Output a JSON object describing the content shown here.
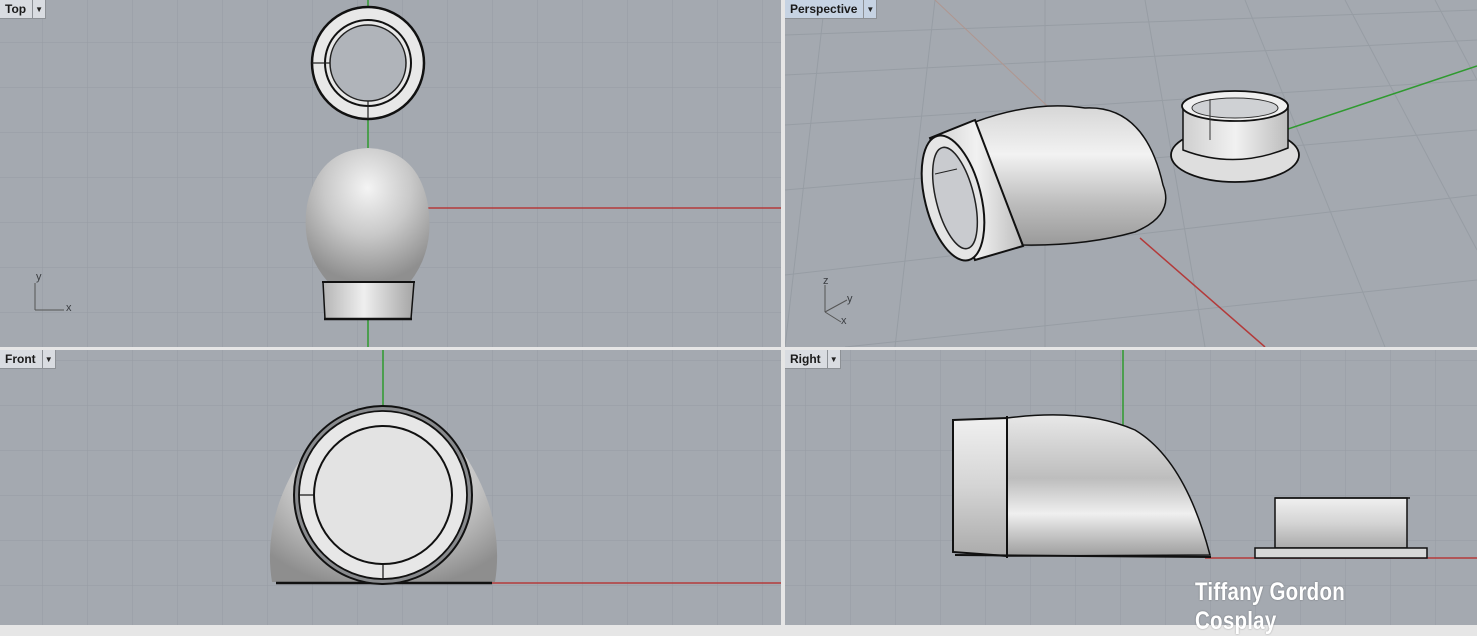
{
  "viewports": {
    "top": {
      "label": "Top",
      "axes": {
        "a": "y",
        "b": "x"
      }
    },
    "perspective": {
      "label": "Perspective",
      "axes": {
        "a": "z",
        "b": "y",
        "c": "x"
      }
    },
    "front": {
      "label": "Front"
    },
    "right": {
      "label": "Right"
    }
  },
  "watermark": "Tiffany Gordon Cosplay",
  "colors": {
    "viewport_bg": "#a4a9b0",
    "grid": "#949aa1",
    "axis_x": "#b33a3a",
    "axis_y": "#2f9a2f",
    "active_tab": "#c6d3e3"
  },
  "icons": {
    "dropdown": "chevron-down-icon"
  }
}
